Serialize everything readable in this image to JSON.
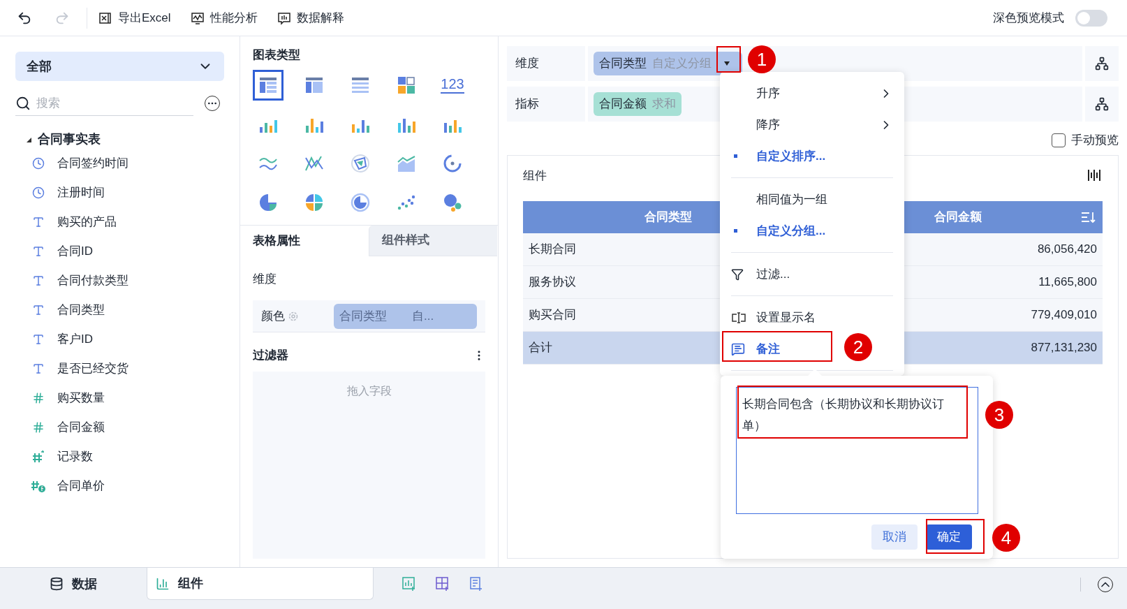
{
  "toolbar": {
    "undo": {
      "disabled": false
    },
    "redo": {
      "disabled": true
    },
    "actions": [
      "导出Excel",
      "性能分析",
      "数据解释"
    ],
    "dark_preview": {
      "label": "深色预览模式",
      "on": false
    }
  },
  "data_panel": {
    "scope": "全部",
    "search": {
      "placeholder": "搜索"
    },
    "table": {
      "name": "合同事实表",
      "expanded": true,
      "fields": [
        {
          "label": "合同签约时间",
          "kind": "date"
        },
        {
          "label": "注册时间",
          "kind": "date"
        },
        {
          "label": "购买的产品",
          "kind": "text"
        },
        {
          "label": "合同ID",
          "kind": "text"
        },
        {
          "label": "合同付款类型",
          "kind": "text"
        },
        {
          "label": "合同类型",
          "kind": "text"
        },
        {
          "label": "客户ID",
          "kind": "text"
        },
        {
          "label": "是否已经交货",
          "kind": "text"
        },
        {
          "label": "购买数量",
          "kind": "number"
        },
        {
          "label": "合同金额",
          "kind": "number"
        },
        {
          "label": "记录数",
          "kind": "count"
        },
        {
          "label": "合同单价",
          "kind": "formula"
        }
      ]
    }
  },
  "chart_panel": {
    "title": "图表类型",
    "chart_types": [
      {
        "selected": true
      },
      {
        "selected": false
      },
      {
        "selected": false
      },
      {
        "selected": false
      },
      {
        "selected": false,
        "label": "123"
      },
      {
        "selected": false
      },
      {
        "selected": false
      },
      {
        "selected": false
      },
      {
        "selected": false
      },
      {
        "selected": false
      },
      {
        "selected": false
      },
      {
        "selected": false
      },
      {
        "selected": false
      },
      {
        "selected": false
      },
      {
        "selected": false
      },
      {
        "selected": false
      },
      {
        "selected": false
      },
      {
        "selected": false
      },
      {
        "selected": false
      },
      {
        "selected": false
      }
    ],
    "tabs": [
      {
        "label": "表格属性",
        "selected": true
      },
      {
        "label": "组件样式",
        "selected": false
      }
    ],
    "dimension_label": "维度",
    "color_row": {
      "label": "颜色",
      "chip": "合同类型",
      "chip_suffix": "自..."
    },
    "filter": {
      "title": "过滤器",
      "placeholder": "拖入字段"
    }
  },
  "editor": {
    "dimension": {
      "label": "维度",
      "chip": "合同类型",
      "chip_suffix": "自定义分组"
    },
    "measure": {
      "label": "指标",
      "chip": "合同金额",
      "chip_suffix": "求和"
    },
    "manual_preview": {
      "label": "手动预览",
      "checked": false
    },
    "widget": {
      "title": "组件",
      "table": {
        "columns": [
          "合同类型",
          "合同金额"
        ],
        "rows": [
          {
            "cells": [
              "长期合同",
              "86,056,420"
            ],
            "kind": "data"
          },
          {
            "cells": [
              "服务协议",
              "11,665,800"
            ],
            "kind": "data"
          },
          {
            "cells": [
              "购买合同",
              "779,409,010"
            ],
            "kind": "data"
          },
          {
            "cells": [
              "合计",
              "877,131,230"
            ],
            "kind": "total"
          }
        ]
      }
    }
  },
  "menu": {
    "groups": [
      [
        {
          "label": "升序",
          "kind": "submenu",
          "selected": false
        },
        {
          "label": "降序",
          "kind": "submenu",
          "selected": false
        },
        {
          "label": "自定义排序...",
          "kind": "option",
          "selected": true
        }
      ],
      [
        {
          "label": "相同值为一组",
          "kind": "option",
          "selected": false
        },
        {
          "label": "自定义分组...",
          "kind": "option",
          "selected": true
        }
      ],
      [
        {
          "label": "过滤...",
          "kind": "filter",
          "selected": false
        }
      ],
      [
        {
          "label": "设置显示名",
          "kind": "rename",
          "selected": false
        },
        {
          "label": "备注",
          "kind": "note",
          "selected": true
        }
      ]
    ]
  },
  "note_popover": {
    "value": "长期合同包含（长期协议和长期协议订单）",
    "buttons": [
      {
        "label": "取消",
        "kind": "secondary"
      },
      {
        "label": "确定",
        "kind": "primary"
      }
    ]
  },
  "annotations": [
    "1",
    "2",
    "3",
    "4"
  ],
  "bottom_bar": {
    "tabs": [
      {
        "label": "数据",
        "selected": false
      },
      {
        "label": "组件",
        "selected": true
      }
    ]
  }
}
